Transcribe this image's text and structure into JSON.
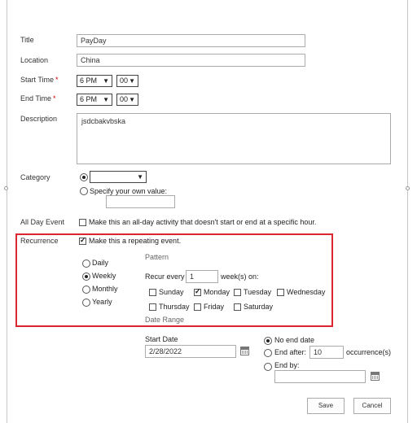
{
  "form": {
    "title_label": "Title",
    "title_value": "PayDay",
    "location_label": "Location",
    "location_value": "China",
    "start_time_label": "Start Time",
    "start_hour": "6 PM",
    "start_minute": "00",
    "end_time_label": "End Time",
    "end_hour": "6 PM",
    "end_minute": "00",
    "required_mark": "*",
    "description_label": "Description",
    "description_value": "jsdcbakvbska",
    "category_label": "Category",
    "category_value": "",
    "category_custom": "Specify your own value:",
    "category_custom_value": "",
    "all_day_label": "All Day Event",
    "all_day_text": "Make this an all-day activity that doesn't start or end at a specific hour.",
    "all_day_checked": false
  },
  "recurrence": {
    "label": "Recurrence",
    "repeat_text": "Make this a repeating event.",
    "repeat_checked": true,
    "frequencies": [
      "Daily",
      "Weekly",
      "Monthly",
      "Yearly"
    ],
    "selected_frequency": "Weekly",
    "pattern_label": "Pattern",
    "recur_every_label": "Recur every",
    "recur_every_value": "1",
    "weeks_on_label": "week(s) on:",
    "days": [
      "Sunday",
      "Monday",
      "Tuesday",
      "Wednesday",
      "Thursday",
      "Friday",
      "Saturday"
    ],
    "checked_days": [
      "Monday"
    ],
    "date_range_label": "Date Range",
    "start_date_label": "Start Date",
    "start_date_value": "2/28/2022",
    "no_end_date": "No end date",
    "end_after": "End after:",
    "end_after_value": "10",
    "occurrences": "occurrence(s)",
    "end_by": "End by:",
    "end_by_value": "",
    "selected_end": "No end date"
  },
  "buttons": {
    "save": "Save",
    "cancel": "Cancel"
  }
}
